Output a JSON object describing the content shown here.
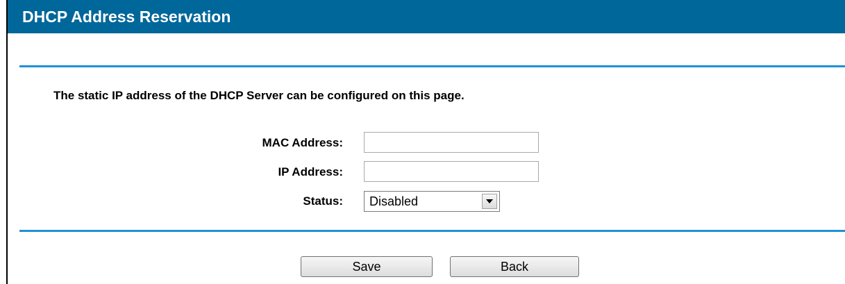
{
  "page": {
    "title": "DHCP Address Reservation"
  },
  "description": "The static IP address of the DHCP Server can be configured on this page.",
  "form": {
    "mac": {
      "label": "MAC Address:",
      "value": ""
    },
    "ip": {
      "label": "IP Address:",
      "value": ""
    },
    "status": {
      "label": "Status:",
      "value": "Disabled",
      "icon": "dropdown-arrow-icon"
    }
  },
  "buttons": {
    "save": "Save",
    "back": "Back"
  },
  "colors": {
    "title_bar": "#00679a",
    "rule": "#1e90d6"
  }
}
